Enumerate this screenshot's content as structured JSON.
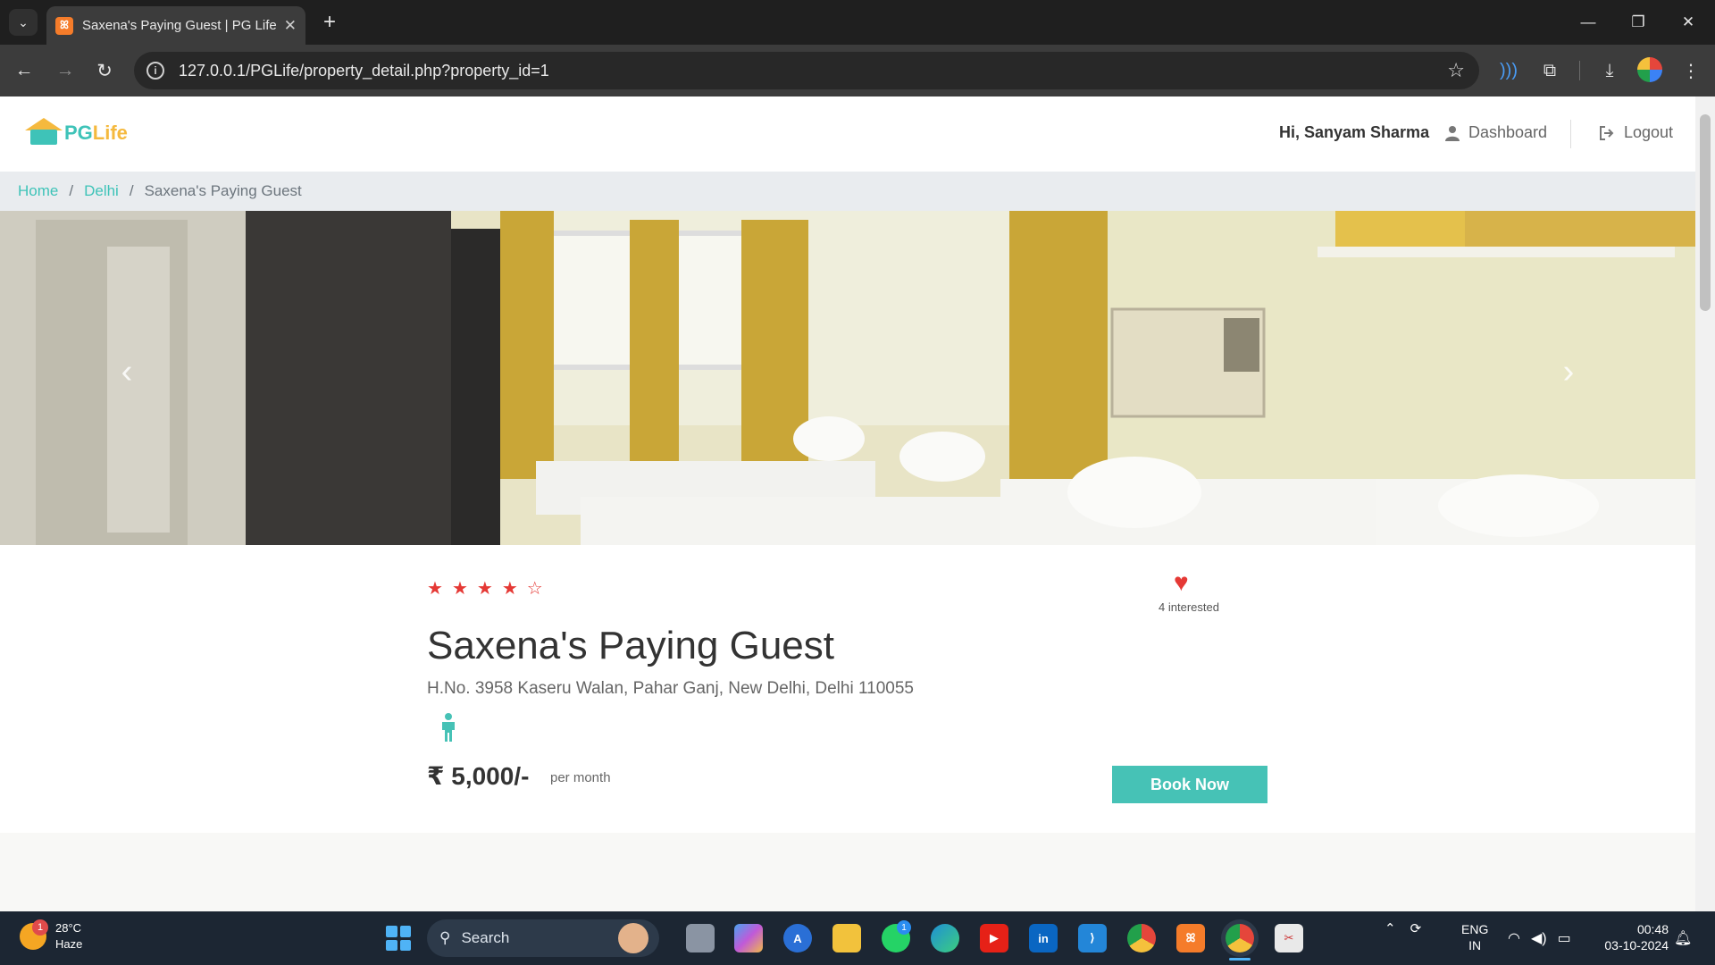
{
  "browser": {
    "tab_title": "Saxena's Paying Guest | PG Life",
    "url": "127.0.0.1/PGLife/property_detail.php?property_id=1"
  },
  "nav": {
    "logo_pg": "PG",
    "logo_life": "Life",
    "greeting": "Hi, Sanyam Sharma",
    "dashboard": "Dashboard",
    "logout": "Logout"
  },
  "breadcrumb": {
    "home": "Home",
    "city": "Delhi",
    "current": "Saxena's Paying Guest"
  },
  "carousel": {
    "slide_count": 2,
    "active_index": 0
  },
  "property": {
    "rating": 4,
    "rating_max": 5,
    "interested": "4 interested",
    "name": "Saxena's Paying Guest",
    "address": "H.No. 3958 Kaseru Walan, Pahar Ganj, New Delhi, Delhi 110055",
    "gender_icon": "male-icon",
    "price": "₹ 5,000/-",
    "price_unit": "per month",
    "book_label": "Book Now"
  },
  "taskbar": {
    "weather_temp": "28°C",
    "weather_desc": "Haze",
    "weather_badge": "1",
    "search_label": "Search",
    "lang_1": "ENG",
    "lang_2": "IN",
    "time": "00:48",
    "date": "03-10-2024",
    "whatsapp_badge": "1"
  },
  "colors": {
    "accent": "#46c2b6",
    "star": "#e53935",
    "logo_yellow": "#f5b93e"
  }
}
